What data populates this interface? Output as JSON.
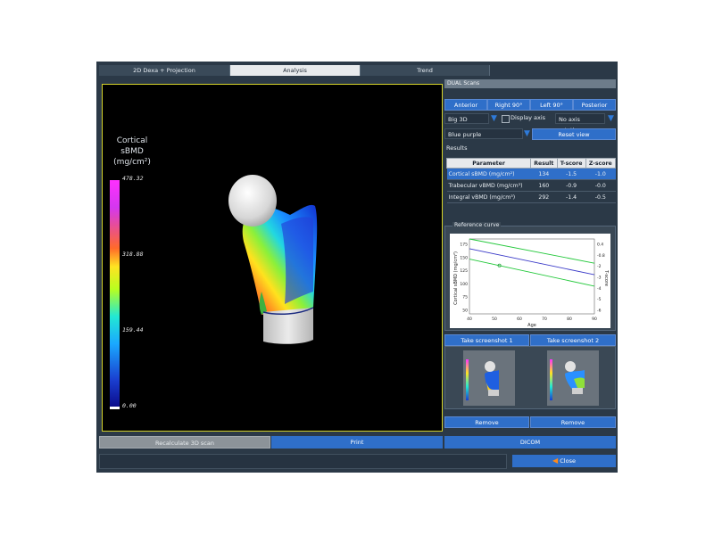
{
  "tabs": [
    "2D Dexa + Projection",
    "Analysis",
    "Trend"
  ],
  "active_tab": "Analysis",
  "colorbar": {
    "title_lines": [
      "Cortical",
      "sBMD",
      "(mg/cm²)"
    ],
    "labels": [
      "478.32",
      "318.88",
      "159.44",
      "0.00"
    ]
  },
  "right_panel": {
    "title": "DUAL Scans",
    "view_buttons": [
      "Anterior",
      "Right 90°",
      "Left 90°",
      "Posterior"
    ],
    "mode_select": "Big 3D",
    "display_axis_label": "Display axis",
    "display_axis_checked": false,
    "rotation_select": "No axis rotation",
    "colormap_select": "Blue purple",
    "reset_view_label": "Reset view",
    "results_label": "Results",
    "results_table": {
      "headers": [
        "Parameter",
        "Result",
        "T-score",
        "Z-score"
      ],
      "rows": [
        [
          "Cortical sBMD (mg/cm²)",
          "134",
          "-1.5",
          "-1.0"
        ],
        [
          "Trabecular vBMD (mg/cm³)",
          "160",
          "-0.9",
          "-0.0"
        ],
        [
          "Integral vBMD (mg/cm³)",
          "292",
          "-1.4",
          "-0.5"
        ]
      ],
      "selected_row": 0
    },
    "reference_curve": {
      "title": "Reference curve",
      "x_label": "Age",
      "y_label": "Cortical sBMD (mg/cm²)",
      "y2_label": "T-score",
      "x_ticks": [
        "40",
        "50",
        "60",
        "70",
        "80",
        "90"
      ],
      "y_ticks": [
        "175",
        "150",
        "125",
        "100",
        "75",
        "50"
      ],
      "y2_ticks": [
        "0.4",
        "-0.8",
        "-2",
        "-3",
        "-4",
        "-5",
        "-6"
      ]
    },
    "screenshot_buttons": [
      "Take screenshot 1",
      "Take screenshot 2"
    ],
    "remove_buttons": [
      "Remove",
      "Remove"
    ]
  },
  "bottom": {
    "recalc_label": "Recalculate 3D scan",
    "print_label": "Print",
    "dicom_label": "DICOM",
    "close_label": "Close"
  },
  "chart_data": {
    "type": "line",
    "x_label": "Age",
    "y_label": "Cortical sBMD (mg/cm²)",
    "x_range": [
      40,
      90
    ],
    "y_range": [
      50,
      180
    ],
    "series": [
      {
        "x": [
          40,
          90
        ],
        "y": [
          180,
          138
        ]
      },
      {
        "x": [
          40,
          90
        ],
        "y": [
          163,
          118
        ]
      },
      {
        "x": [
          40,
          90
        ],
        "y": [
          145,
          98
        ]
      }
    ],
    "points": [
      {
        "x": 52,
        "y": 134
      }
    ]
  }
}
